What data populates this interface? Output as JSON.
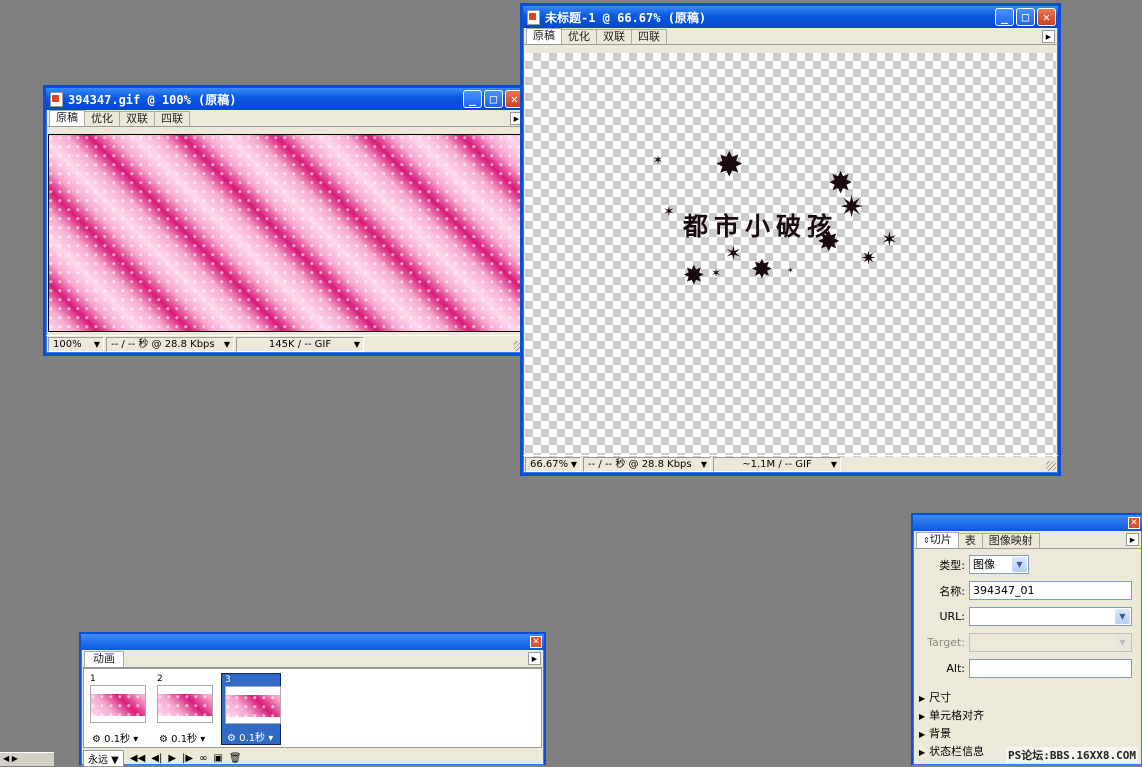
{
  "window_gif": {
    "title": "394347.gif @ 100% (原稿)",
    "tabs": [
      "原稿",
      "优化",
      "双联",
      "四联"
    ],
    "zoom": "100%",
    "download_time": "-- / -- 秒 @ 28.8 Kbps",
    "file_size": "145K / -- GIF"
  },
  "window_untitled": {
    "title": "未标题-1 @ 66.67% (原稿)",
    "tabs": [
      "原稿",
      "优化",
      "双联",
      "四联"
    ],
    "zoom": "66.67%",
    "download_time": "-- / -- 秒 @ 28.8 Kbps",
    "file_size": "~1.1M / -- GIF",
    "canvas_text": "都市小破孩"
  },
  "animation_panel": {
    "tab": "动画",
    "frames": [
      {
        "num": "1",
        "delay": "0.1秒"
      },
      {
        "num": "2",
        "delay": "0.1秒"
      },
      {
        "num": "3",
        "delay": "0.1秒"
      }
    ],
    "loop": "永远"
  },
  "slice_panel": {
    "tabs": [
      "切片",
      "表",
      "图像映射"
    ],
    "type_label": "类型:",
    "type_value": "图像",
    "name_label": "名称:",
    "name_value": "394347_01",
    "url_label": "URL:",
    "url_value": "",
    "target_label": "Target:",
    "target_value": "",
    "alt_label": "Alt:",
    "alt_value": "",
    "sections": [
      "尺寸",
      "单元格对齐",
      "背景",
      "状态栏信息"
    ]
  },
  "watermark": "PS论坛:BBS.16XX8.COM",
  "colors": {
    "desktop": "#7f7f7f",
    "title_blue": "#0a58e0",
    "pink_dark": "#d81b78",
    "pink_light": "#ffd8ec"
  }
}
